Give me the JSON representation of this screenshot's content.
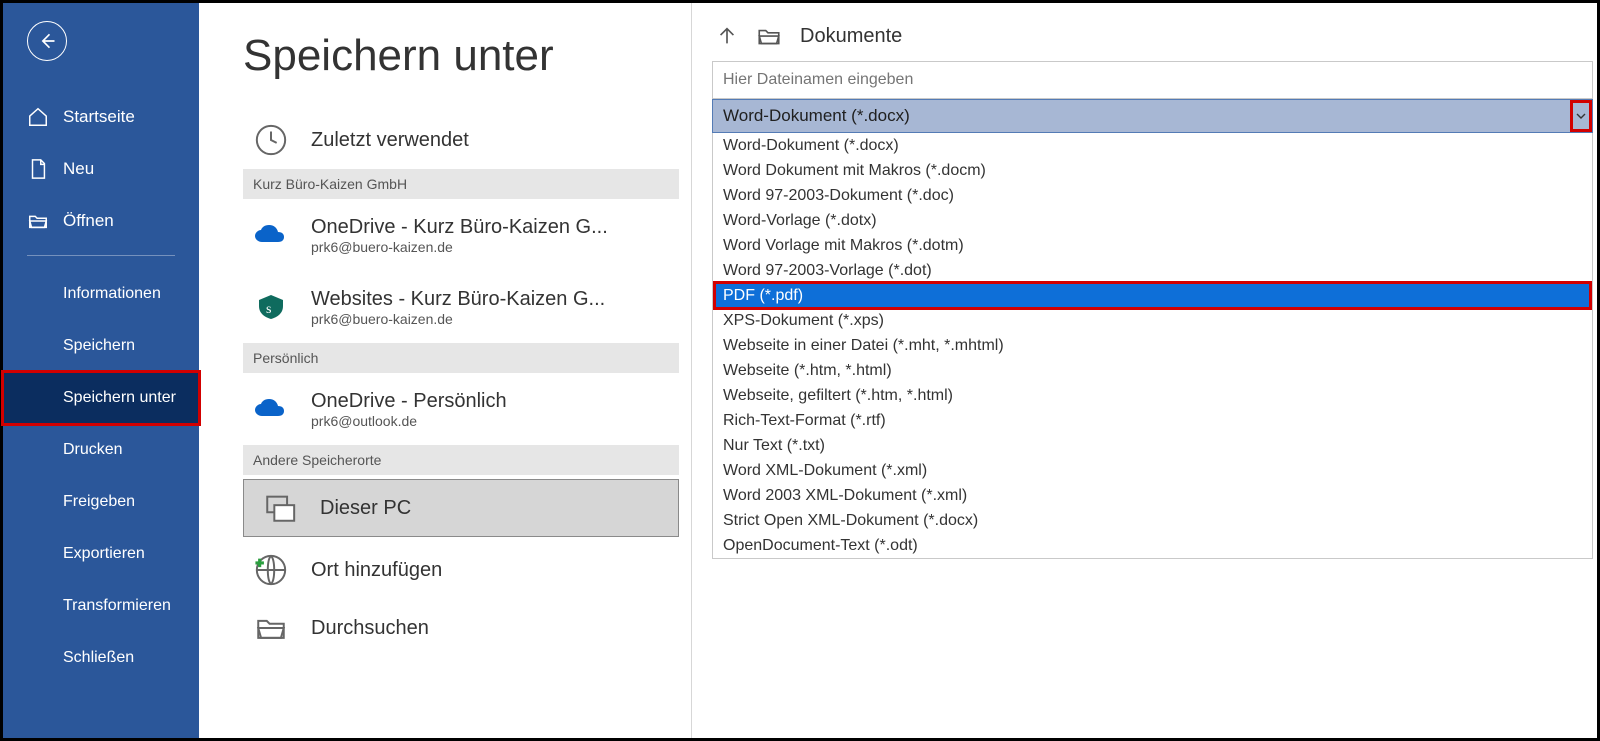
{
  "page": {
    "title": "Speichern unter"
  },
  "sidebar": {
    "items": [
      {
        "label": "Startseite",
        "icon": "home"
      },
      {
        "label": "Neu",
        "icon": "file"
      },
      {
        "label": "Öffnen",
        "icon": "folder-open"
      }
    ],
    "subitems": [
      {
        "label": "Informationen"
      },
      {
        "label": "Speichern"
      },
      {
        "label": "Speichern unter",
        "selected": true
      },
      {
        "label": "Drucken"
      },
      {
        "label": "Freigeben"
      },
      {
        "label": "Exportieren"
      },
      {
        "label": "Transformieren"
      },
      {
        "label": "Schließen"
      }
    ]
  },
  "locations": {
    "recent": {
      "label": "Zuletzt verwendet"
    },
    "group1_header": "Kurz Büro-Kaizen GmbH",
    "group1": [
      {
        "title": "OneDrive - Kurz Büro-Kaizen G...",
        "sub": "prk6@buero-kaizen.de",
        "icon": "onedrive"
      },
      {
        "title": "Websites - Kurz Büro-Kaizen G...",
        "sub": "prk6@buero-kaizen.de",
        "icon": "sharepoint"
      }
    ],
    "group2_header": "Persönlich",
    "group2": [
      {
        "title": "OneDrive - Persönlich",
        "sub": "prk6@outlook.de",
        "icon": "onedrive"
      }
    ],
    "group3_header": "Andere Speicherorte",
    "this_pc": {
      "label": "Dieser PC"
    },
    "add_place": {
      "label": "Ort hinzufügen"
    },
    "browse": {
      "label": "Durchsuchen"
    }
  },
  "right": {
    "breadcrumb": "Dokumente",
    "filename_placeholder": "Hier Dateinamen eingeben",
    "selected_type": "Word-Dokument (*.docx)",
    "types": [
      "Word-Dokument (*.docx)",
      "Word Dokument mit Makros (*.docm)",
      "Word 97-2003-Dokument (*.doc)",
      "Word-Vorlage (*.dotx)",
      "Word Vorlage mit Makros (*.dotm)",
      "Word 97-2003-Vorlage (*.dot)",
      "PDF (*.pdf)",
      "XPS-Dokument (*.xps)",
      "Webseite in einer Datei (*.mht, *.mhtml)",
      "Webseite (*.htm, *.html)",
      "Webseite, gefiltert (*.htm, *.html)",
      "Rich-Text-Format (*.rtf)",
      "Nur Text (*.txt)",
      "Word XML-Dokument (*.xml)",
      "Word 2003 XML-Dokument (*.xml)",
      "Strict Open XML-Dokument (*.docx)",
      "OpenDocument-Text (*.odt)"
    ],
    "highlighted_type_index": 6
  }
}
